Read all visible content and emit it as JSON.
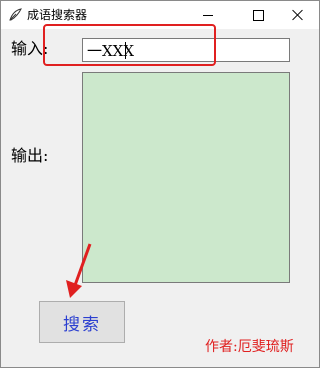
{
  "window": {
    "title": "成语搜索器"
  },
  "form": {
    "input_label": "输入:",
    "input_value": "一XXX",
    "output_label": "输出:",
    "output_value": "",
    "search_button_label": "搜索"
  },
  "footer": {
    "author": "作者:厄斐琉斯"
  },
  "colors": {
    "output_bg": "#cce8cc",
    "annotation": "#e02020",
    "button_text": "#2b3fd0"
  }
}
